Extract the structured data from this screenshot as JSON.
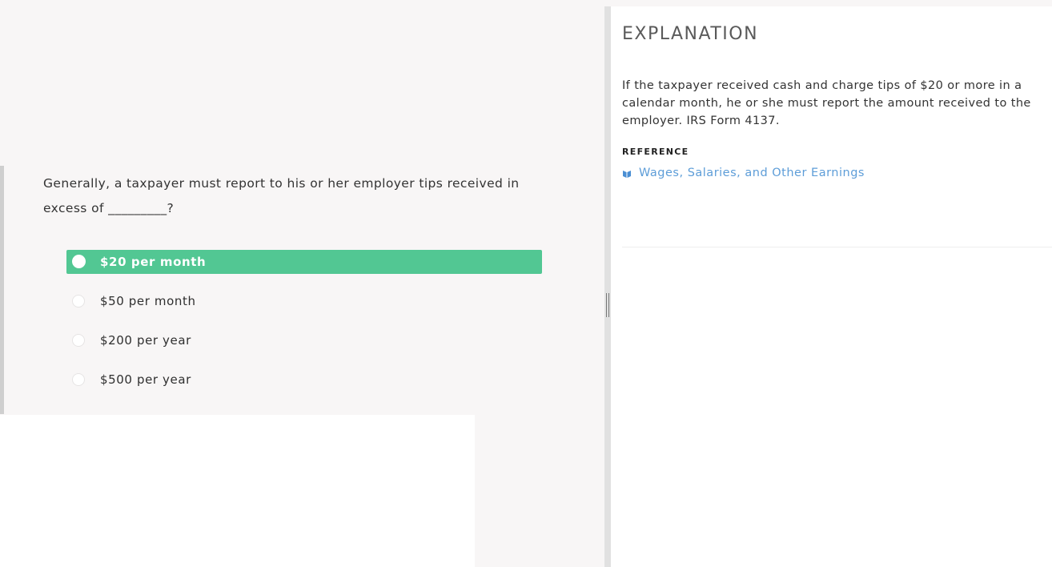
{
  "question": {
    "text": "Generally, a taxpayer must report to his or her employer tips received in excess of _________?"
  },
  "options": [
    {
      "label": "$20 per month",
      "selected": true
    },
    {
      "label": "$50 per month",
      "selected": false
    },
    {
      "label": "$200 per year",
      "selected": false
    },
    {
      "label": "$500 per year",
      "selected": false
    }
  ],
  "explanation": {
    "title": "EXPLANATION",
    "text": "If the taxpayer received cash and charge tips of $20 or more in a calendar month, he or she must report the amount received to the employer. IRS Form 4137.",
    "reference_heading": "REFERENCE",
    "reference_link": "Wages, Salaries, and Other Earnings",
    "reference_icon": "book-icon"
  },
  "colors": {
    "selected_option": "#52c793",
    "link": "#5d9dd8",
    "background": "#f8f6f6"
  }
}
